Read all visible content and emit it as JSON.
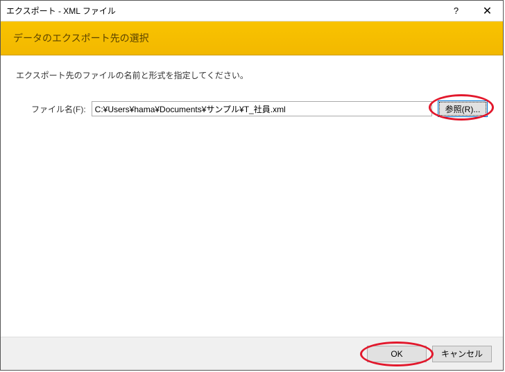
{
  "title": "エクスポート - XML ファイル",
  "header": {
    "title": "データのエクスポート先の選択"
  },
  "instruction": "エクスポート先のファイルの名前と形式を指定してください。",
  "form": {
    "filename_label": "ファイル名(F):",
    "filename_value": "C:¥Users¥hama¥Documents¥サンプル¥T_社員.xml",
    "browse_label": "参照(R)..."
  },
  "footer": {
    "ok_label": "OK",
    "cancel_label": "キャンセル"
  }
}
